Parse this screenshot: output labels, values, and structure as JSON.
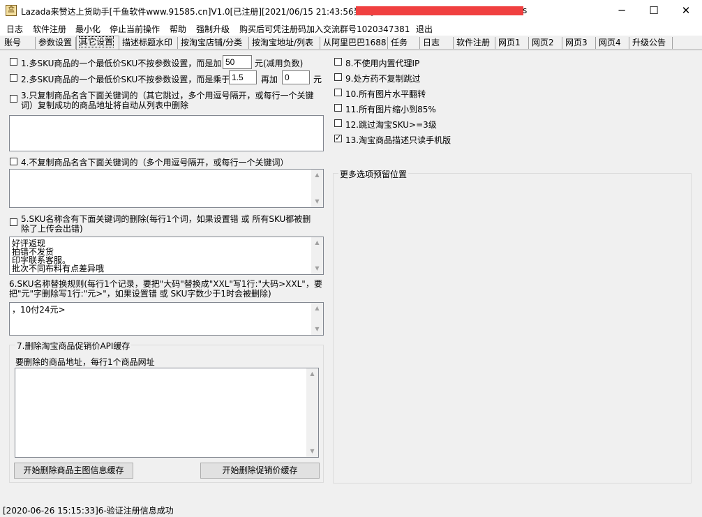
{
  "window": {
    "title": "Lazada来赞达上货助手[千鱼软件www.91585.cn]V1.0[已注册][2021/06/15 21:43:56到期]",
    "title_tail": "s",
    "icon": "app-icon",
    "minimize_icon": "minimize-icon",
    "maximize_icon": "maximize-icon",
    "close_icon": "close-icon"
  },
  "menu": [
    "日志",
    "软件注册",
    "最小化",
    "停止当前操作",
    "帮助",
    "强制升级",
    "购买后可凭注册码加入交流群号1020347381",
    "退出"
  ],
  "tabs": [
    "账号",
    "参数设置",
    "其它设置",
    "描述标题水印",
    "按淘宝店铺/分类",
    "按淘宝地址/列表",
    "从阿里巴巴1688",
    "任务",
    "日志",
    "软件注册",
    "网页1",
    "网页2",
    "网页3",
    "网页4",
    "升级公告"
  ],
  "active_tab_index": 2,
  "left": {
    "opt1": {
      "label_a": "1.多SKU商品的一个最低价SKU不按参数设置，而是加",
      "value": "50",
      "label_b": "元(减用负数)",
      "checked": false
    },
    "opt2": {
      "label_a": "2.多SKU商品的一个最低价SKU不按参数设置，而是乘于",
      "value_mul": "1.5",
      "label_mid": "再加",
      "value_add": "0",
      "label_b": "元",
      "checked": false
    },
    "opt3": {
      "line1": "3.只复制商品名含下面关键词的（其它跳过，多个用逗号隔开，或每行一个关键",
      "line2": "词）复制成功的商品地址将自动从列表中删除",
      "checked": false
    },
    "opt4": {
      "label": "4.不复制商品名含下面关键词的（多个用逗号隔开，或每行一个关键词）",
      "checked": false
    },
    "opt5": {
      "line1": "5.SKU名称含有下面关键词的删除(每行1个词，如果设置错  或  所有SKU都被删",
      "line2": "除了上传会出错)",
      "checked": false
    },
    "opt5_memo": "好评返现\n拍错不发货\n印字联系客服。\n批次不同布料有点差异哦",
    "opt6": {
      "line1": "6.SKU名称替换规则(每行1个记录，要把\"大码\"替换成\"XXL\"写1行:\"大码>XXL\"，要",
      "line2": "把\"元\"字删除写1行:\"元>\"，如果设置错  或 SKU字数少于1时会被删除)"
    },
    "opt6_memo": "，10付24元>",
    "group7": {
      "caption": "7.删除淘宝商品促销价API缓存",
      "label": "要删除的商品地址，每行1个商品网址",
      "btn_main_image": "开始删除商品主图信息缓存",
      "btn_promo": "开始删除促销价缓存"
    }
  },
  "right": {
    "options": [
      {
        "label": "8.不使用内置代理IP",
        "checked": false
      },
      {
        "label": "9.处方药不复制跳过",
        "checked": false
      },
      {
        "label": "10.所有图片水平翻转",
        "checked": false
      },
      {
        "label": "11.所有图片缩小到85%",
        "checked": false
      },
      {
        "label": "12.跳过淘宝SKU>=3级",
        "checked": false
      },
      {
        "label": "13.淘宝商品描述只读手机版",
        "checked": true
      }
    ],
    "group_caption": "更多选项预留位置"
  },
  "status": "[2020-06-26 15:15:33]6-验证注册信息成功"
}
